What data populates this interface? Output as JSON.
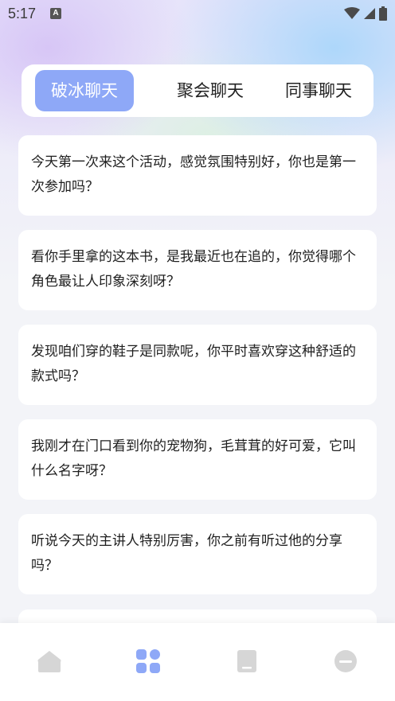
{
  "status_bar": {
    "time": "5:17",
    "badge": "A"
  },
  "tabs": [
    {
      "label": "破冰聊天",
      "active": true
    },
    {
      "label": "聚会聊天",
      "active": false
    },
    {
      "label": "同事聊天",
      "active": false
    }
  ],
  "cards": [
    {
      "text": "今天第一次来这个活动，感觉氛围特别好，你也是第一次参加吗？"
    },
    {
      "text": "看你手里拿的这本书，是我最近也在追的，你觉得哪个角色最让人印象深刻呀？"
    },
    {
      "text": "发现咱们穿的鞋子是同款呢，你平时喜欢穿这种舒适的款式吗？"
    },
    {
      "text": "我刚才在门口看到你的宠物狗，毛茸茸的好可爱，它叫什么名字呀？"
    },
    {
      "text": "听说今天的主讲人特别厉害，你之前有听过他的分享吗？"
    }
  ],
  "bottom_nav": {
    "items": [
      {
        "icon": "home-icon",
        "active": false
      },
      {
        "icon": "grid-icon",
        "active": true
      },
      {
        "icon": "book-icon",
        "active": false
      },
      {
        "icon": "profile-icon",
        "active": false
      }
    ],
    "active_color": "#8ea8f7",
    "inactive_color": "#d6d6d6"
  }
}
